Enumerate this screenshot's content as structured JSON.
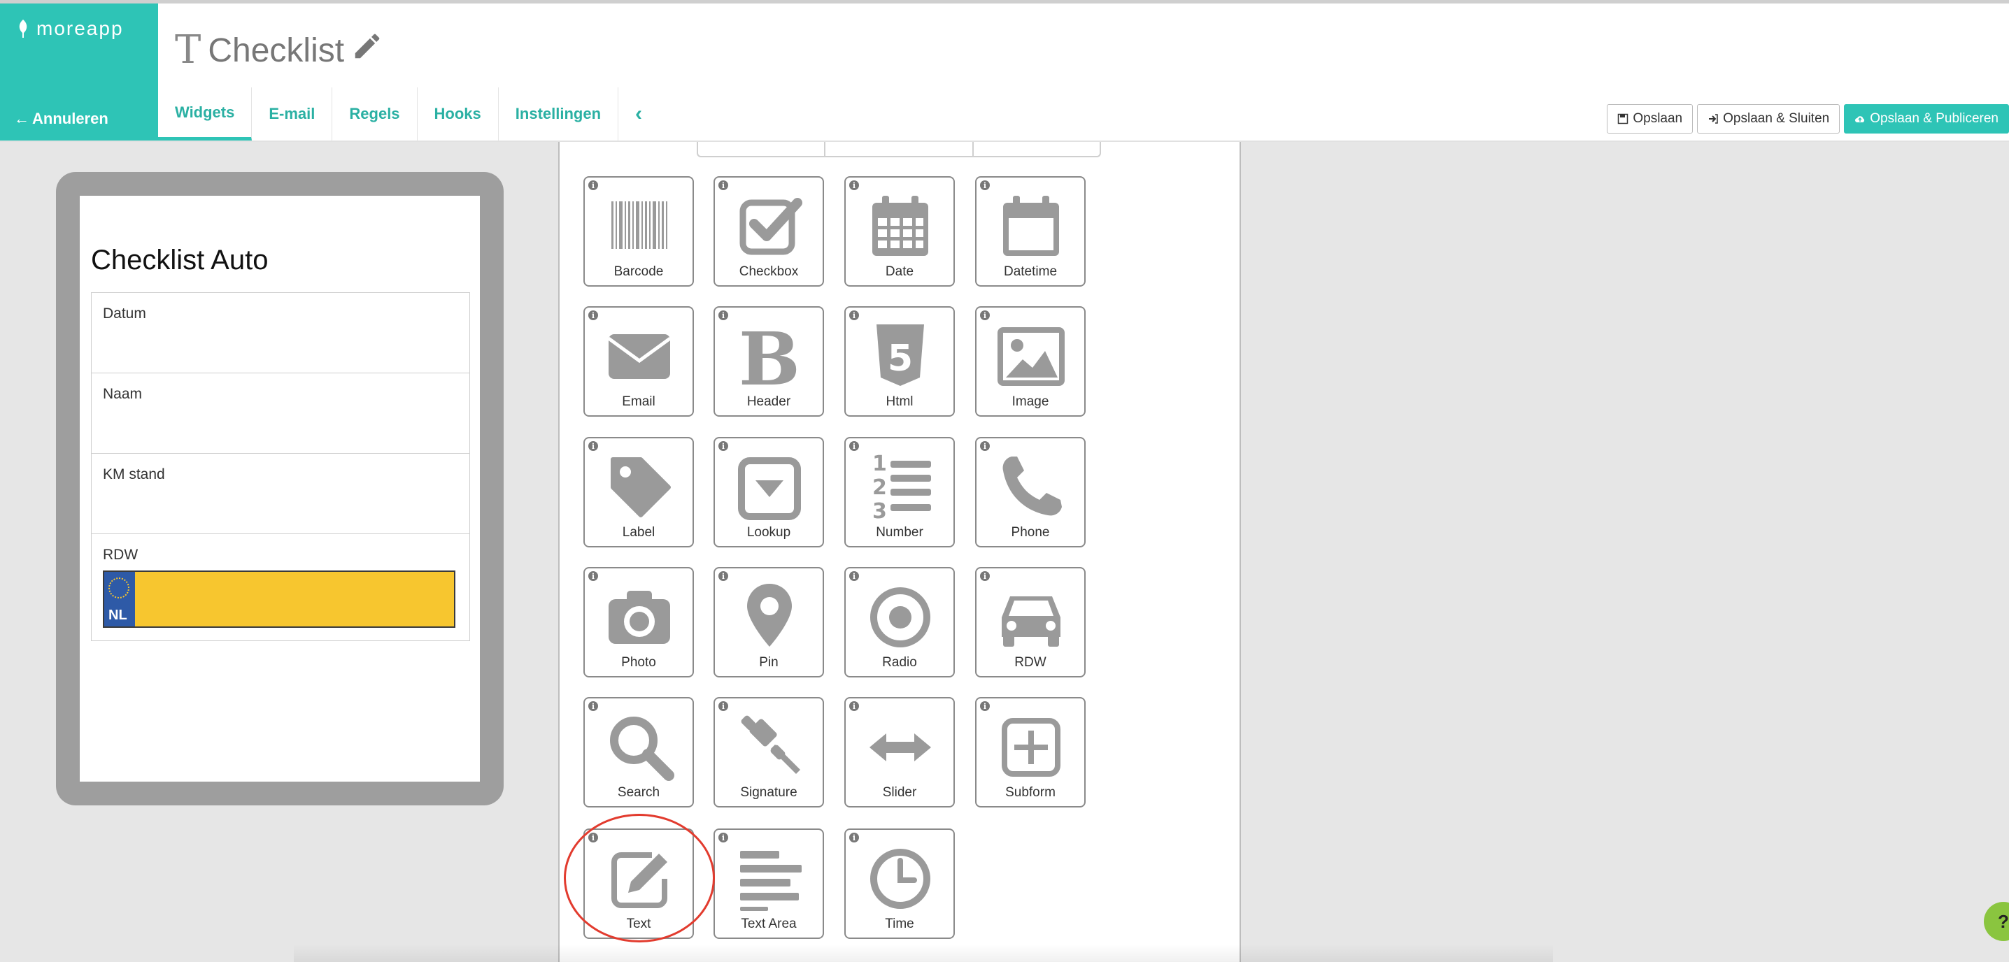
{
  "app": {
    "logo_text": "moreapp",
    "cancel_label": "Annuleren",
    "title": "Checklist",
    "title_icon": "text-cursor-icon",
    "edit_icon": "pencil-icon"
  },
  "tabs": [
    {
      "label": "Widgets",
      "active": true
    },
    {
      "label": "E-mail"
    },
    {
      "label": "Regels"
    },
    {
      "label": "Hooks"
    },
    {
      "label": "Instellingen"
    }
  ],
  "collapse_icon": "chevron-left-icon",
  "actions": {
    "save": "Opslaan",
    "save_close": "Opslaan & Sluiten",
    "save_publish": "Opslaan & Publiceren"
  },
  "preview": {
    "form_title": "Checklist Auto",
    "fields": [
      {
        "label": "Datum"
      },
      {
        "label": "Naam"
      },
      {
        "label": "KM stand"
      },
      {
        "label": "RDW",
        "plate_country": "NL"
      }
    ]
  },
  "widgets": [
    {
      "label": "Barcode",
      "icon": "barcode-icon"
    },
    {
      "label": "Checkbox",
      "icon": "checkbox-icon"
    },
    {
      "label": "Date",
      "icon": "calendar-icon"
    },
    {
      "label": "Datetime",
      "icon": "calendar-empty-icon"
    },
    {
      "label": "Email",
      "icon": "envelope-icon"
    },
    {
      "label": "Header",
      "icon": "bold-icon"
    },
    {
      "label": "Html",
      "icon": "html5-icon"
    },
    {
      "label": "Image",
      "icon": "image-icon"
    },
    {
      "label": "Label",
      "icon": "tag-icon"
    },
    {
      "label": "Lookup",
      "icon": "dropdown-icon"
    },
    {
      "label": "Number",
      "icon": "numbered-list-icon"
    },
    {
      "label": "Phone",
      "icon": "phone-icon"
    },
    {
      "label": "Photo",
      "icon": "camera-icon"
    },
    {
      "label": "Pin",
      "icon": "map-pin-icon"
    },
    {
      "label": "Radio",
      "icon": "radio-icon"
    },
    {
      "label": "RDW",
      "icon": "car-icon"
    },
    {
      "label": "Search",
      "icon": "search-icon"
    },
    {
      "label": "Signature",
      "icon": "gavel-icon"
    },
    {
      "label": "Slider",
      "icon": "arrows-horizontal-icon"
    },
    {
      "label": "Subform",
      "icon": "plus-square-icon"
    },
    {
      "label": "Text",
      "icon": "edit-icon",
      "highlighted": true
    },
    {
      "label": "Text Area",
      "icon": "align-left-icon"
    },
    {
      "label": "Time",
      "icon": "clock-icon"
    }
  ],
  "help_label": "?",
  "colors": {
    "brand": "#2ec4b6",
    "highlight": "#e23b2e",
    "icon": "#9a9a9a",
    "plate": "#f7c62f"
  }
}
